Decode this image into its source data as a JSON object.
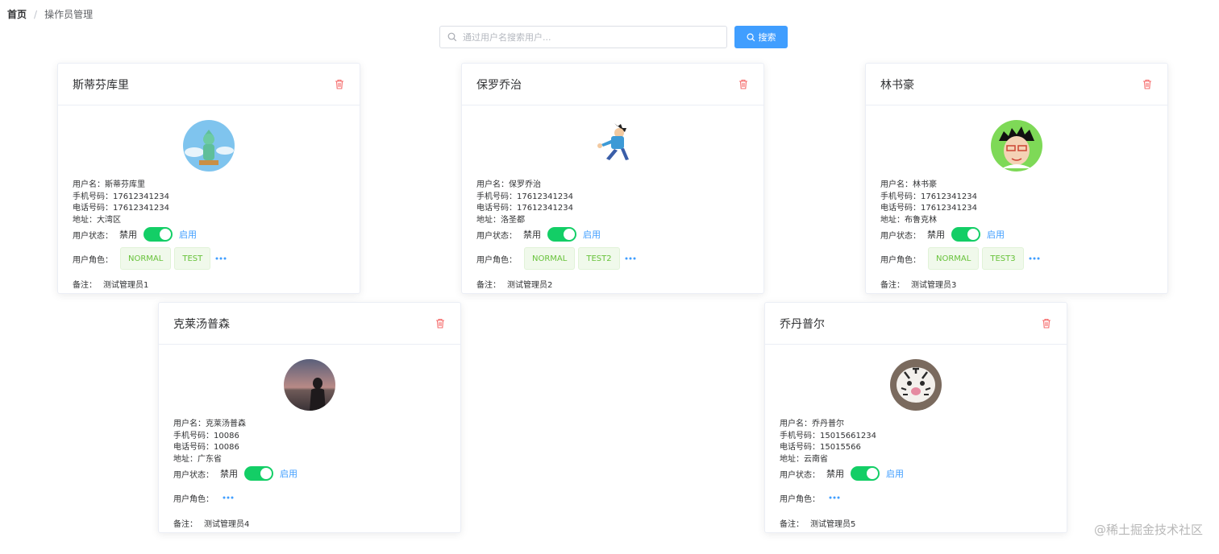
{
  "breadcrumb": {
    "home": "首页",
    "separator": "/",
    "current": "操作员管理"
  },
  "search": {
    "placeholder": "通过用户名搜索用户...",
    "value": "",
    "button_label": "搜索"
  },
  "labels": {
    "username": "用户名：",
    "mobile": "手机号码：",
    "phone": "电话号码：",
    "address": "地址：",
    "status": "用户状态：",
    "disabled": "禁用",
    "enabled": "启用",
    "roles": "用户角色：",
    "remark": "备注："
  },
  "cards": [
    {
      "title": "斯蒂芬库里",
      "username": "斯蒂芬库里",
      "mobile": "17612341234",
      "phone": "17612341234",
      "address": "大湾区",
      "enabled": true,
      "roles": [
        "NORMAL",
        "TEST"
      ],
      "remark": "测试管理员1"
    },
    {
      "title": "保罗乔治",
      "username": "保罗乔治",
      "mobile": "17612341234",
      "phone": "17612341234",
      "address": "洛圣都",
      "enabled": true,
      "roles": [
        "NORMAL",
        "TEST2"
      ],
      "remark": "测试管理员2"
    },
    {
      "title": "林书豪",
      "username": "林书豪",
      "mobile": "17612341234",
      "phone": "17612341234",
      "address": "布鲁克林",
      "enabled": true,
      "roles": [
        "NORMAL",
        "TEST3"
      ],
      "remark": "测试管理员3"
    },
    {
      "title": "克莱汤普森",
      "username": "克莱汤普森",
      "mobile": "10086",
      "phone": "10086",
      "address": "广东省",
      "enabled": true,
      "roles": [],
      "remark": "测试管理员4"
    },
    {
      "title": "乔丹普尔",
      "username": "乔丹普尔",
      "mobile": "15015661234",
      "phone": "15015566",
      "address": "云南省",
      "enabled": true,
      "roles": [],
      "remark": "测试管理员5"
    }
  ],
  "colors": {
    "primary": "#409eff",
    "switch_on": "#13ce66",
    "tag_text": "#67c23a",
    "tag_bg": "#f0f9eb",
    "delete": "#f56c6c"
  },
  "watermark": "@稀土掘金技术社区"
}
